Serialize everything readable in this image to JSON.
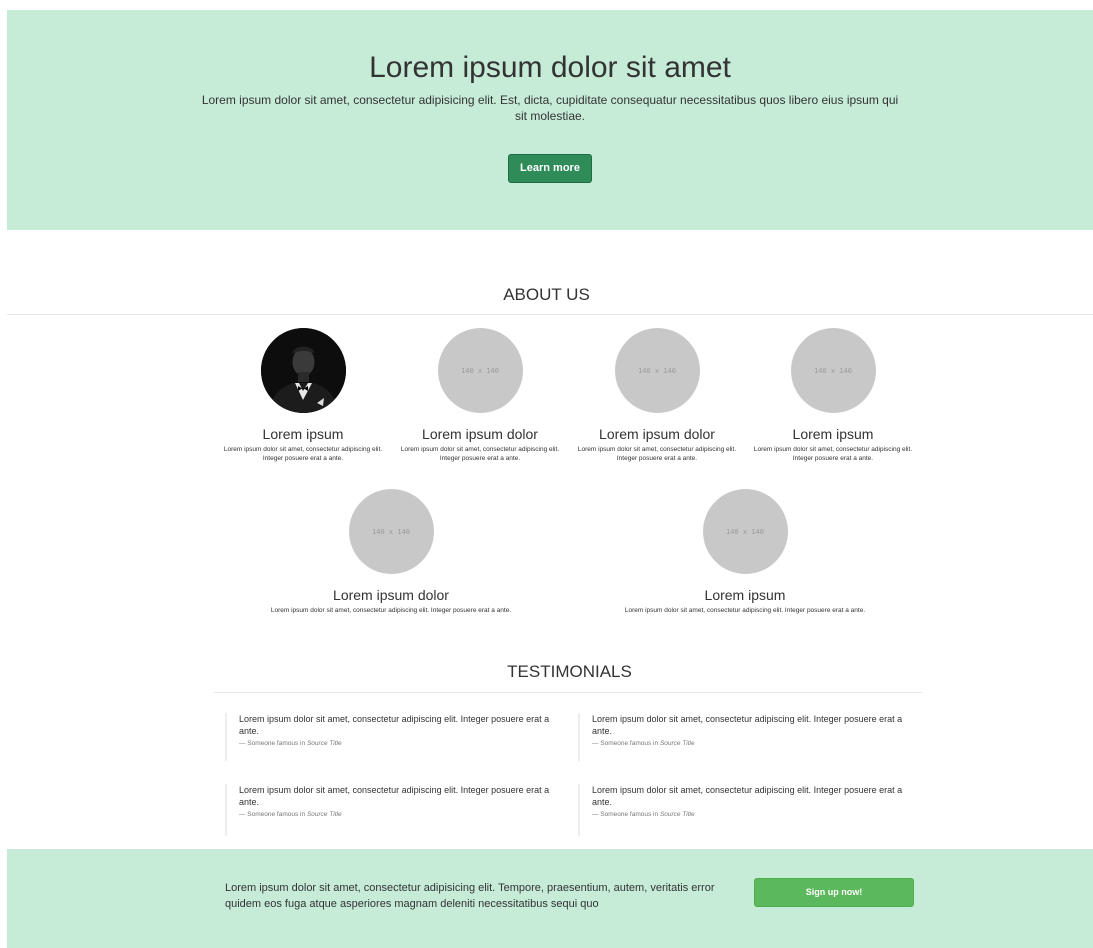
{
  "hero": {
    "title": "Lorem ipsum dolor sit amet",
    "text": "Lorem ipsum dolor sit amet, consectetur adipisicing elit. Est, dicta, cupiditate consequatur necessitatibus quos libero eius ipsum qui sit molestiae.",
    "button": "Learn more"
  },
  "about": {
    "title": "ABOUT US",
    "members": [
      {
        "name": "Lorem ipsum",
        "text": "Lorem ipsum dolor sit amet, consectetur adipiscing elit. Integer posuere erat a ante.",
        "image": "person-in-tuxedo-photo"
      },
      {
        "name": "Lorem ipsum dolor",
        "text": "Lorem ipsum dolor sit amet, consectetur adipiscing elit. Integer posuere erat a ante.",
        "image_label": "140 x 140"
      },
      {
        "name": "Lorem ipsum dolor",
        "text": "Lorem ipsum dolor sit amet, consectetur adipiscing elit. Integer posuere erat a ante.",
        "image_label": "140 x 140"
      },
      {
        "name": "Lorem ipsum",
        "text": "Lorem ipsum dolor sit amet, consectetur adipiscing elit. Integer posuere erat a ante.",
        "image_label": "140 x 140"
      },
      {
        "name": "Lorem ipsum dolor",
        "text": "Lorem ipsum dolor sit amet, consectetur adipiscing elit. Integer posuere erat a ante.",
        "image_label": "140 x 140"
      },
      {
        "name": "Lorem ipsum",
        "text": "Lorem ipsum dolor sit amet, consectetur adipiscing elit. Integer posuere erat a ante.",
        "image_label": "140 x 140"
      }
    ]
  },
  "testimonials": {
    "title": "TESTIMONIALS",
    "items": [
      {
        "quote": "Lorem ipsum dolor sit amet, consectetur adipiscing elit. Integer posuere erat a ante.",
        "author": "— Someone famous in ",
        "source": "Source Title"
      },
      {
        "quote": "Lorem ipsum dolor sit amet, consectetur adipiscing elit. Integer posuere erat a ante.",
        "author": "— Someone famous in ",
        "source": "Source Title"
      },
      {
        "quote": "Lorem ipsum dolor sit amet, consectetur adipiscing elit. Integer posuere erat a ante.",
        "author": "— Someone famous in ",
        "source": "Source Title"
      },
      {
        "quote": "Lorem ipsum dolor sit amet, consectetur adipiscing elit. Integer posuere erat a ante.",
        "author": "— Someone famous in ",
        "source": "Source Title"
      }
    ]
  },
  "footer": {
    "text": "Lorem ipsum dolor sit amet, consectetur adipisicing elit. Tempore, praesentium, autem, veritatis error quidem eos fuga atque asperiores magnam deleniti necessitatibus sequi quo",
    "button": "Sign up now!"
  },
  "colors": {
    "band": "#c6ecd7",
    "primary_button": "#2f8b58",
    "signup_button": "#5cb85c"
  }
}
